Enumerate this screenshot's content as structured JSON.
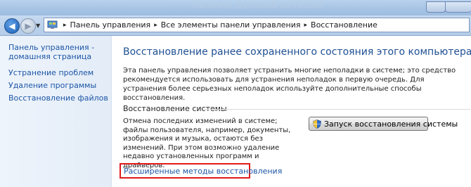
{
  "titlebar": {
    "ghost_text": "наличии, доставка по России"
  },
  "address": {
    "breadcrumbs": [
      "Панель управления",
      "Все элементы панели управления",
      "Восстановление"
    ]
  },
  "left_pane": {
    "home_label": "Панель управления - домашняя страница",
    "items": [
      "Устранение проблем",
      "Удаление программы",
      "Восстановление файлов"
    ]
  },
  "main": {
    "heading": "Восстановление ранее сохраненного состояния этого компьютера",
    "description": "Эта панель управления позволяет устранить многие неполадки в системе; это средство рекомендуется использовать для устранения неполадок в первую очередь. Для устранения более серьезных неполадок используйте дополнительные способы восстановления.",
    "section_title": "Восстановление системы",
    "section_body": "Отмена последних изменений в системе; файлы пользователя, например, документы, изображения и музыка, остаются без изменений. При этом возможно удаление недавно установленных программ и драйверов.",
    "restore_button_label": "Запуск восстановления системы",
    "advanced_link": "Расширенные методы восстановления"
  },
  "colors": {
    "link": "#1d56a6",
    "heading": "#1e4f93",
    "highlight_border": "#e01b1b"
  }
}
